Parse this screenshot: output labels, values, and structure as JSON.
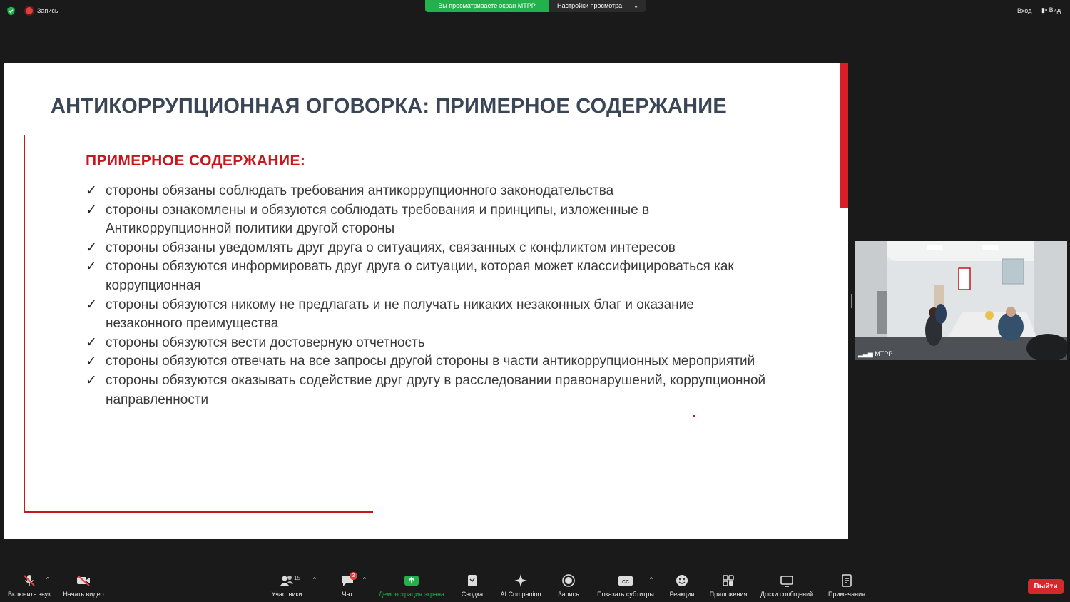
{
  "topbar": {
    "recording_label": "Запись",
    "share_banner": "Вы просматриваете экран МТРР",
    "view_settings": "Настройки просмотра",
    "enter_label": "Вход",
    "view_label": "Вид"
  },
  "slide": {
    "title": "АНТИКОРРУПЦИОННАЯ ОГОВОРКА: ПРИМЕРНОЕ СОДЕРЖАНИЕ",
    "subtitle": "ПРИМЕРНОЕ СОДЕРЖАНИЕ:",
    "check_mark": "✓",
    "items": [
      "стороны обязаны соблюдать требования антикоррупционного законодательства",
      "стороны ознакомлены и обязуются соблюдать требования и принципы, изложенные в Антикоррупционной политики другой стороны",
      "стороны обязаны уведомлять друг друга о ситуациях, связанных с конфликтом интересов",
      "стороны обязуются информировать друг друга о ситуации, которая может классифицироваться как коррупционная",
      "стороны обязуются никому не предлагать и не получать никаких незаконных благ и оказание незаконного преимущества",
      "стороны обязуются вести достоверную отчетность",
      "стороны обязуются отвечать на все запросы другой стороны в части антикоррупционных мероприятий",
      "стороны обязуются оказывать содействие друг другу в расследовании правонарушений, коррупционной направленности"
    ],
    "accent_color": "#c8161d"
  },
  "video": {
    "participant_name": "МТРР"
  },
  "toolbar": {
    "mute_label": "Включить звук",
    "video_label": "Начать видео",
    "participants_label": "Участники",
    "participants_count": "15",
    "chat_label": "Чат",
    "chat_badge": "3",
    "share_label": "Демонстрация экрана",
    "summary_label": "Сводка",
    "ai_label": "AI Companion",
    "record_label": "Запись",
    "captions_label": "Показать субтитры",
    "reactions_label": "Реакции",
    "apps_label": "Приложения",
    "whiteboards_label": "Доски сообщений",
    "notes_label": "Примечания",
    "exit_label": "Выйти",
    "share_color": "#23b14d",
    "exit_color": "#d1292c"
  }
}
